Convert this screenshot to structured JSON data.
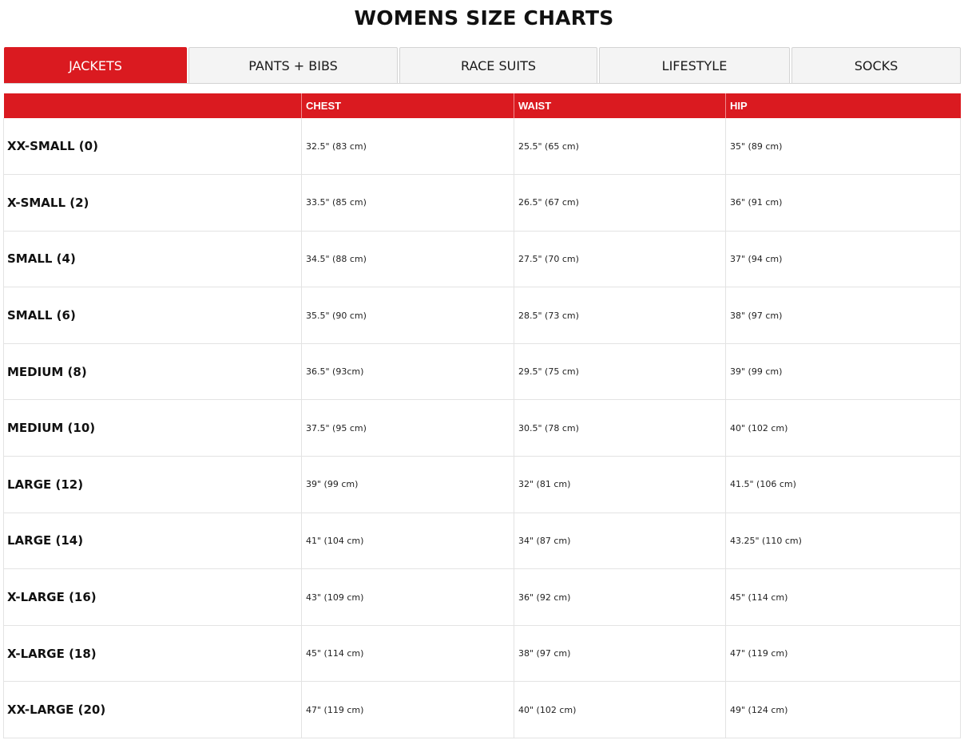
{
  "page": {
    "title": "WOMENS SIZE CHARTS"
  },
  "colors": {
    "accent": "#da1a20",
    "tab_inactive_bg": "#f4f4f4",
    "border": "#e3e3e3",
    "text": "#111111"
  },
  "tabs": [
    {
      "label": "JACKETS",
      "active": true
    },
    {
      "label": "PANTS + BIBS",
      "active": false
    },
    {
      "label": "RACE SUITS",
      "active": false
    },
    {
      "label": "LIFESTYLE",
      "active": false
    },
    {
      "label": "SOCKS",
      "active": false
    }
  ],
  "table": {
    "headers": [
      "",
      "CHEST",
      "WAIST",
      "HIP"
    ],
    "rows": [
      {
        "size": "XX-SMALL (0)",
        "chest": "32.5\" (83 cm)",
        "waist": "25.5\" (65 cm)",
        "hip": "35\" (89 cm)"
      },
      {
        "size": "X-SMALL (2)",
        "chest": "33.5\" (85 cm)",
        "waist": "26.5\" (67 cm)",
        "hip": "36\" (91 cm)"
      },
      {
        "size": "SMALL (4)",
        "chest": "34.5\" (88 cm)",
        "waist": "27.5\" (70 cm)",
        "hip": "37\" (94 cm)"
      },
      {
        "size": "SMALL (6)",
        "chest": "35.5\" (90 cm)",
        "waist": "28.5\" (73 cm)",
        "hip": "38\" (97 cm)"
      },
      {
        "size": "MEDIUM (8)",
        "chest": "36.5\" (93cm)",
        "waist": "29.5\" (75 cm)",
        "hip": "39\" (99 cm)"
      },
      {
        "size": "MEDIUM (10)",
        "chest": "37.5\" (95 cm)",
        "waist": "30.5\" (78 cm)",
        "hip": "40\" (102 cm)"
      },
      {
        "size": "LARGE (12)",
        "chest": "39\" (99 cm)",
        "waist": "32\" (81 cm)",
        "hip": "41.5\" (106 cm)"
      },
      {
        "size": "LARGE (14)",
        "chest": "41\" (104 cm)",
        "waist": "34\" (87 cm)",
        "hip": "43.25\" (110 cm)"
      },
      {
        "size": "X-LARGE (16)",
        "chest": "43\" (109 cm)",
        "waist": "36\" (92 cm)",
        "hip": "45\" (114 cm)"
      },
      {
        "size": "X-LARGE (18)",
        "chest": "45\" (114 cm)",
        "waist": "38\" (97 cm)",
        "hip": "47\" (119 cm)"
      },
      {
        "size": "XX-LARGE (20)",
        "chest": "47\" (119 cm)",
        "waist": "40\" (102 cm)",
        "hip": "49\" (124 cm)"
      }
    ]
  }
}
